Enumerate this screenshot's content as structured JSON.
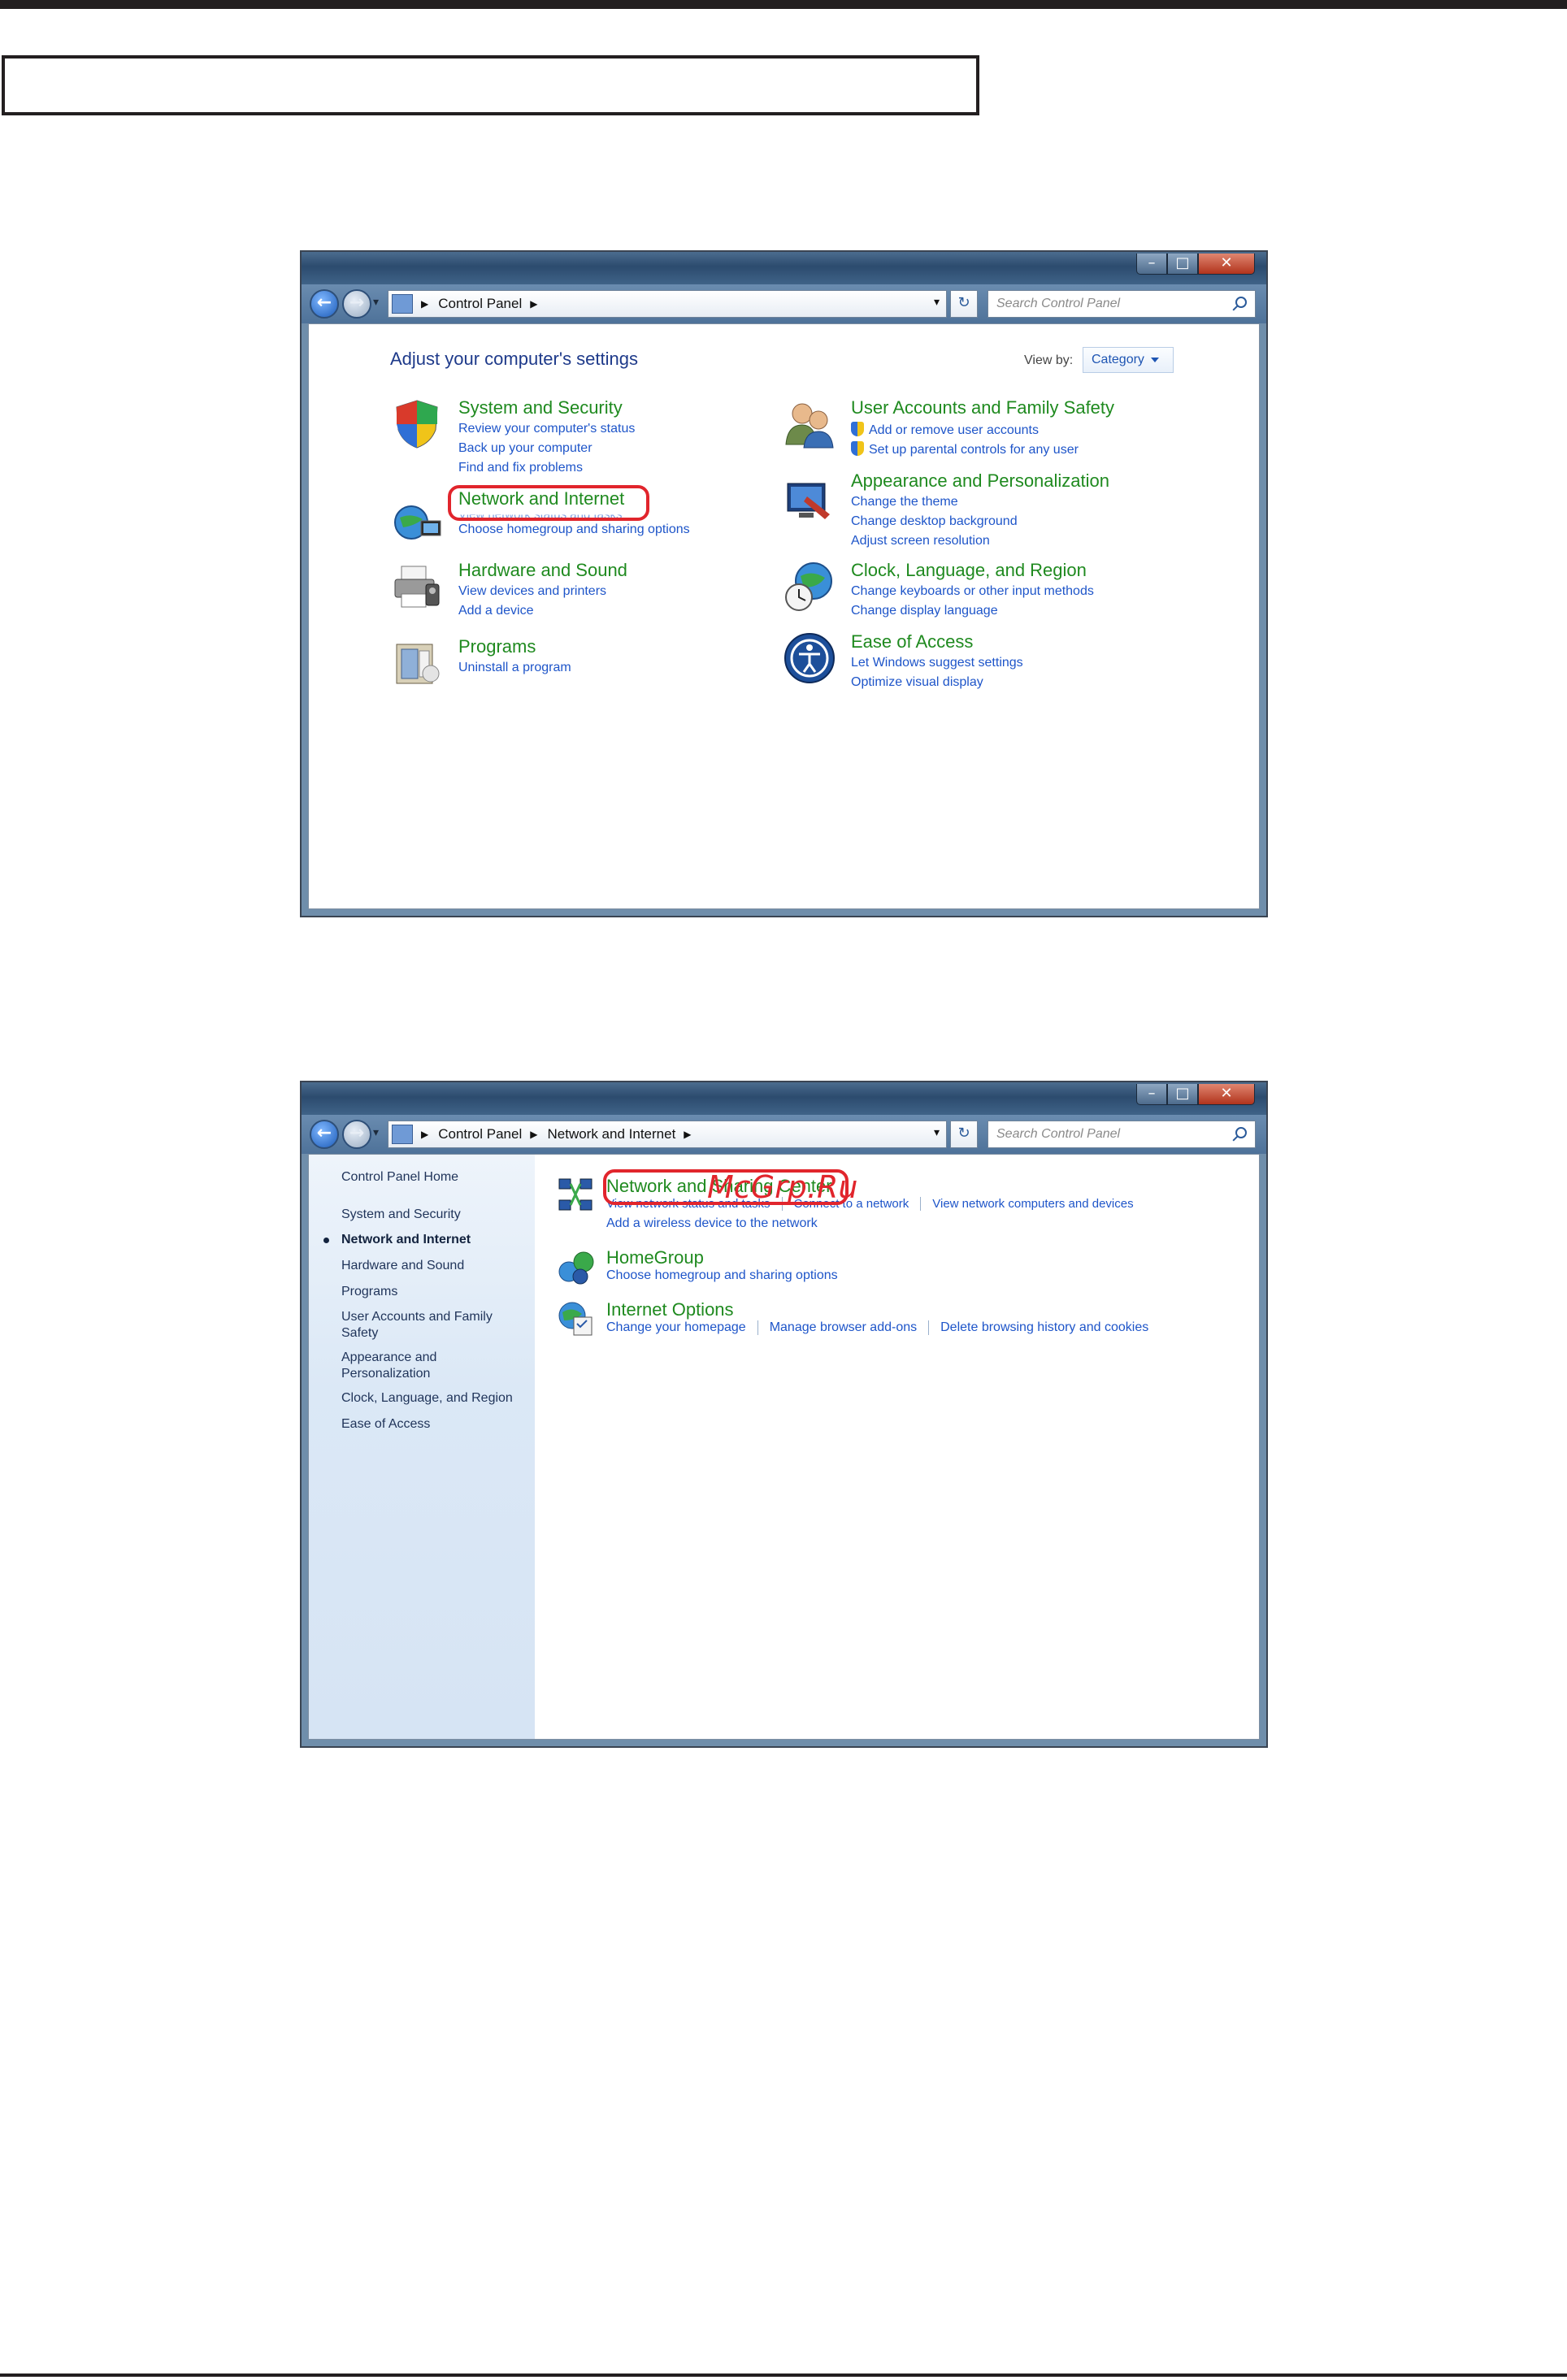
{
  "window_a": {
    "breadcrumb": [
      "Control Panel"
    ],
    "search_placeholder": "Search Control Panel",
    "heading": "Adjust your computer's settings",
    "view_by_label": "View by:",
    "view_by_value": "Category",
    "categories_left": [
      {
        "title": "System and Security",
        "links": [
          "Review your computer's status",
          "Back up your computer",
          "Find and fix problems"
        ]
      },
      {
        "title": "Network and Internet",
        "links": [
          "View network status and tasks",
          "Choose homegroup and sharing options"
        ]
      },
      {
        "title": "Hardware and Sound",
        "links": [
          "View devices and printers",
          "Add a device"
        ]
      },
      {
        "title": "Programs",
        "links": [
          "Uninstall a program"
        ]
      }
    ],
    "categories_right": [
      {
        "title": "User Accounts and Family Safety",
        "links": [
          "Add or remove user accounts",
          "Set up parental controls for any user"
        ]
      },
      {
        "title": "Appearance and Personalization",
        "links": [
          "Change the theme",
          "Change desktop background",
          "Adjust screen resolution"
        ]
      },
      {
        "title": "Clock, Language, and Region",
        "links": [
          "Change keyboards or other input methods",
          "Change display language"
        ]
      },
      {
        "title": "Ease of Access",
        "links": [
          "Let Windows suggest settings",
          "Optimize visual display"
        ]
      }
    ]
  },
  "window_b": {
    "breadcrumb": [
      "Control Panel",
      "Network and Internet"
    ],
    "search_placeholder": "Search Control Panel",
    "sidebar": {
      "home": "Control Panel Home",
      "items": [
        "System and Security",
        "Network and Internet",
        "Hardware and Sound",
        "Programs",
        "User Accounts and Family Safety",
        "Appearance and Personalization",
        "Clock, Language, and Region",
        "Ease of Access"
      ],
      "active": "Network and Internet"
    },
    "tasks": [
      {
        "title": "Network and Sharing Center",
        "links": [
          "View network status and tasks",
          "Connect to a network",
          "View network computers and devices"
        ],
        "extra": "Add a wireless device to the network"
      },
      {
        "title": "HomeGroup",
        "links": [
          "Choose homegroup and sharing options"
        ]
      },
      {
        "title": "Internet Options",
        "links": [
          "Change your homepage",
          "Manage browser add-ons",
          "Delete browsing history and cookies"
        ]
      }
    ]
  },
  "watermark": "McGrp.Ru",
  "colors": {
    "link": "#1e55c9",
    "category": "#1f8a1f",
    "highlight": "#e1252c"
  }
}
